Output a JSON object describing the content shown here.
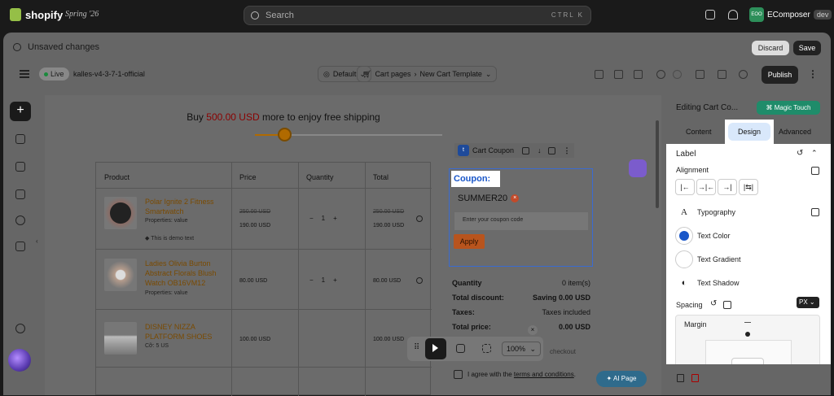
{
  "topbar": {
    "brand": "shopify",
    "edition": "Spring '26",
    "search_placeholder": "Search",
    "search_shortcut": "CTRL K",
    "store_initials": "EOO",
    "store_name": "EComposer",
    "store_badge": "dev"
  },
  "savebar": {
    "message": "Unsaved changes",
    "discard_label": "Discard",
    "save_label": "Save"
  },
  "editor_toolbar": {
    "live_label": "Live",
    "theme_name": "kalles-v4-3-7-1-official",
    "locale": "Default",
    "breadcrumb_page": "Cart pages",
    "breadcrumb_sep": "›",
    "breadcrumb_template": "New Cart Template",
    "publish_label": "Publish"
  },
  "canvas": {
    "promo_prefix": "Buy ",
    "promo_amount": "500.00 USD",
    "promo_middle": " more to enjoy ",
    "promo_bold": "free shipping",
    "shipping_progress_fraction": 0.14,
    "table_headers": [
      "Product",
      "Price",
      "Quantity",
      "Total"
    ],
    "rows": [
      {
        "name": "Polar Ignite 2 Fitness Smartwatch",
        "prop": "Properties: value",
        "note": "This is demo text",
        "price_old": "250.00 USD",
        "price": "190.00 USD",
        "qty": "1",
        "total_old": "250.00 USD",
        "total": "190.00 USD"
      },
      {
        "name": "Ladies Olivia Burton Abstract Florals Blush Watch OB16VM12",
        "prop": "Properties: value",
        "price": "80.00 USD",
        "qty": "1",
        "total": "80.00 USD"
      },
      {
        "name": "DISNEY NIZZA PLATFORM SHOES",
        "prop": "Cỡ: 5 US",
        "price": "100.00 USD",
        "total": "100.00 USD"
      }
    ],
    "coupon_chip_label": "Cart Coupon",
    "coupon_label": "Coupon:",
    "coupon_code": "SUMMER20",
    "coupon_input_placeholder": "Enter your coupon code",
    "apply_label": "Apply",
    "summary": [
      {
        "label": "Quantity",
        "value": "0 item(s)"
      },
      {
        "label": "Total discount:",
        "value": "Saving 0.00 USD"
      },
      {
        "label": "Taxes:",
        "value": "Taxes included"
      },
      {
        "label": "Total price:",
        "value": "0.00 USD"
      }
    ],
    "checkout_label": "checkout",
    "agree_prefix": "I agree with the ",
    "agree_link": "terms and conditions",
    "agree_suffix": ".",
    "ai_page_label": "AI Page",
    "zoom_value": "100%",
    "zoom_caret": "⌄",
    "close_glyph": "×"
  },
  "right_panel": {
    "title": "Editing Cart Co...",
    "magic_touch_label": "Magic Touch",
    "tabs": [
      "Content",
      "Design",
      "Advanced"
    ],
    "active_tab": "Design",
    "section_label": "Label",
    "alignment_label": "Alignment",
    "typography_label": "Typography",
    "text_color_label": "Text Color",
    "text_color_value": "#1a57c9",
    "text_gradient_label": "Text Gradient",
    "text_shadow_label": "Text Shadow",
    "spacing_label": "Spacing",
    "unit_label": "PX",
    "margin_label": "Margin"
  }
}
